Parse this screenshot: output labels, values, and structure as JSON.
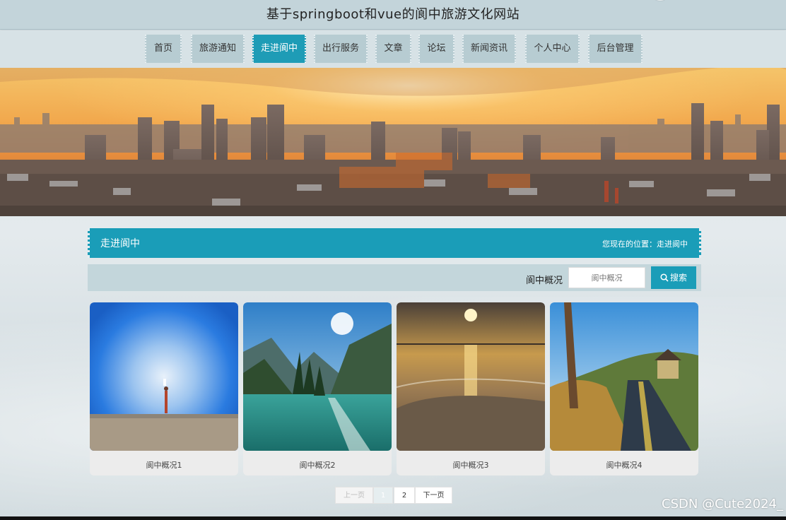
{
  "header": {
    "title": "基于springboot和vue的阆中旅游文化网站"
  },
  "nav": {
    "items": [
      "首页",
      "旅游通知",
      "走进阆中",
      "出行服务",
      "文章",
      "论坛",
      "新闻资讯",
      "个人中心",
      "后台管理"
    ],
    "active_index": 2
  },
  "section": {
    "title": "走进阆中",
    "location": "您现在的位置：走进阆中"
  },
  "search": {
    "label": "阆中概况",
    "placeholder": "阆中概况",
    "button_label": "搜索",
    "icon": "search-icon"
  },
  "cards": [
    {
      "caption": "阆中概况1"
    },
    {
      "caption": "阆中概况2"
    },
    {
      "caption": "阆中概况3"
    },
    {
      "caption": "阆中概况4"
    }
  ],
  "pagination": {
    "prev_label": "上一页",
    "pages": [
      "1",
      "2"
    ],
    "current": "1",
    "next_label": "下一页"
  },
  "watermark": "CSDN @Cute2024_",
  "colors": {
    "accent": "#1a9db8",
    "nav_bg": "#b7ccd2"
  }
}
